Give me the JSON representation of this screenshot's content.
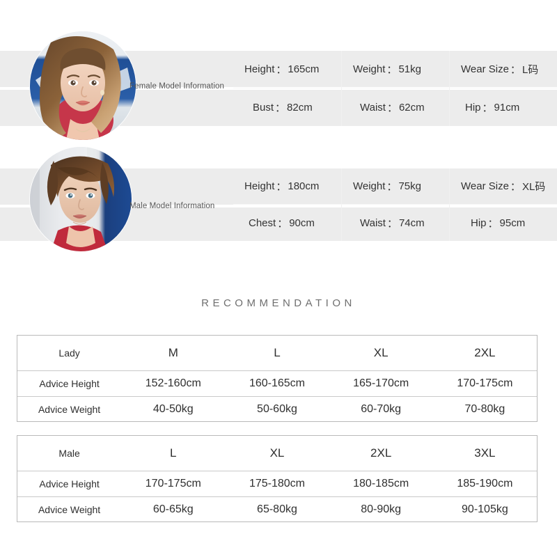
{
  "models": [
    {
      "id": "female",
      "caption": "Female Model Information",
      "avatar_name": "female-model-avatar",
      "fields": [
        {
          "label": "Height",
          "separator": "：",
          "value": "165cm"
        },
        {
          "label": "Weight",
          "separator": "：",
          "value": "51kg"
        },
        {
          "label": "Wear Size",
          "separator": "：",
          "value": "L码"
        },
        {
          "label": "Bust",
          "separator": "：",
          "value": "82cm"
        },
        {
          "label": "Waist",
          "separator": "：",
          "value": "62cm"
        },
        {
          "label": "Hip",
          "separator": "：",
          "value": "91cm"
        }
      ]
    },
    {
      "id": "male",
      "caption": "Male Model Information",
      "avatar_name": "male-model-avatar",
      "fields": [
        {
          "label": "Height",
          "separator": "：",
          "value": "180cm"
        },
        {
          "label": "Weight",
          "separator": "：",
          "value": "75kg"
        },
        {
          "label": "Wear Size",
          "separator": "：",
          "value": "XL码"
        },
        {
          "label": "Chest",
          "separator": "：",
          "value": "90cm"
        },
        {
          "label": "Waist",
          "separator": "：",
          "value": "74cm"
        },
        {
          "label": "Hip",
          "separator": "：",
          "value": "95cm"
        }
      ]
    }
  ],
  "recommendation": {
    "title": "RECOMMENDATION"
  },
  "tables": [
    {
      "id": "lady",
      "header": [
        "Lady",
        "M",
        "L",
        "XL",
        "2XL"
      ],
      "rows": [
        [
          "Advice Height",
          "152-160cm",
          "160-165cm",
          "165-170cm",
          "170-175cm"
        ],
        [
          "Advice Weight",
          "40-50kg",
          "50-60kg",
          "60-70kg",
          "70-80kg"
        ]
      ]
    },
    {
      "id": "male",
      "header": [
        "Male",
        "L",
        "XL",
        "2XL",
        "3XL"
      ],
      "rows": [
        [
          "Advice Height",
          "170-175cm",
          "175-180cm",
          "180-185cm",
          "185-190cm"
        ],
        [
          "Advice Weight",
          "60-65kg",
          "65-80kg",
          "80-90kg",
          "90-105kg"
        ]
      ]
    }
  ],
  "colors": {
    "band": "#ececec",
    "page_background": "#ffffff",
    "table_border": "#b9b9b9",
    "heading_text": "#6f6f6f",
    "body_text": "#333333"
  }
}
